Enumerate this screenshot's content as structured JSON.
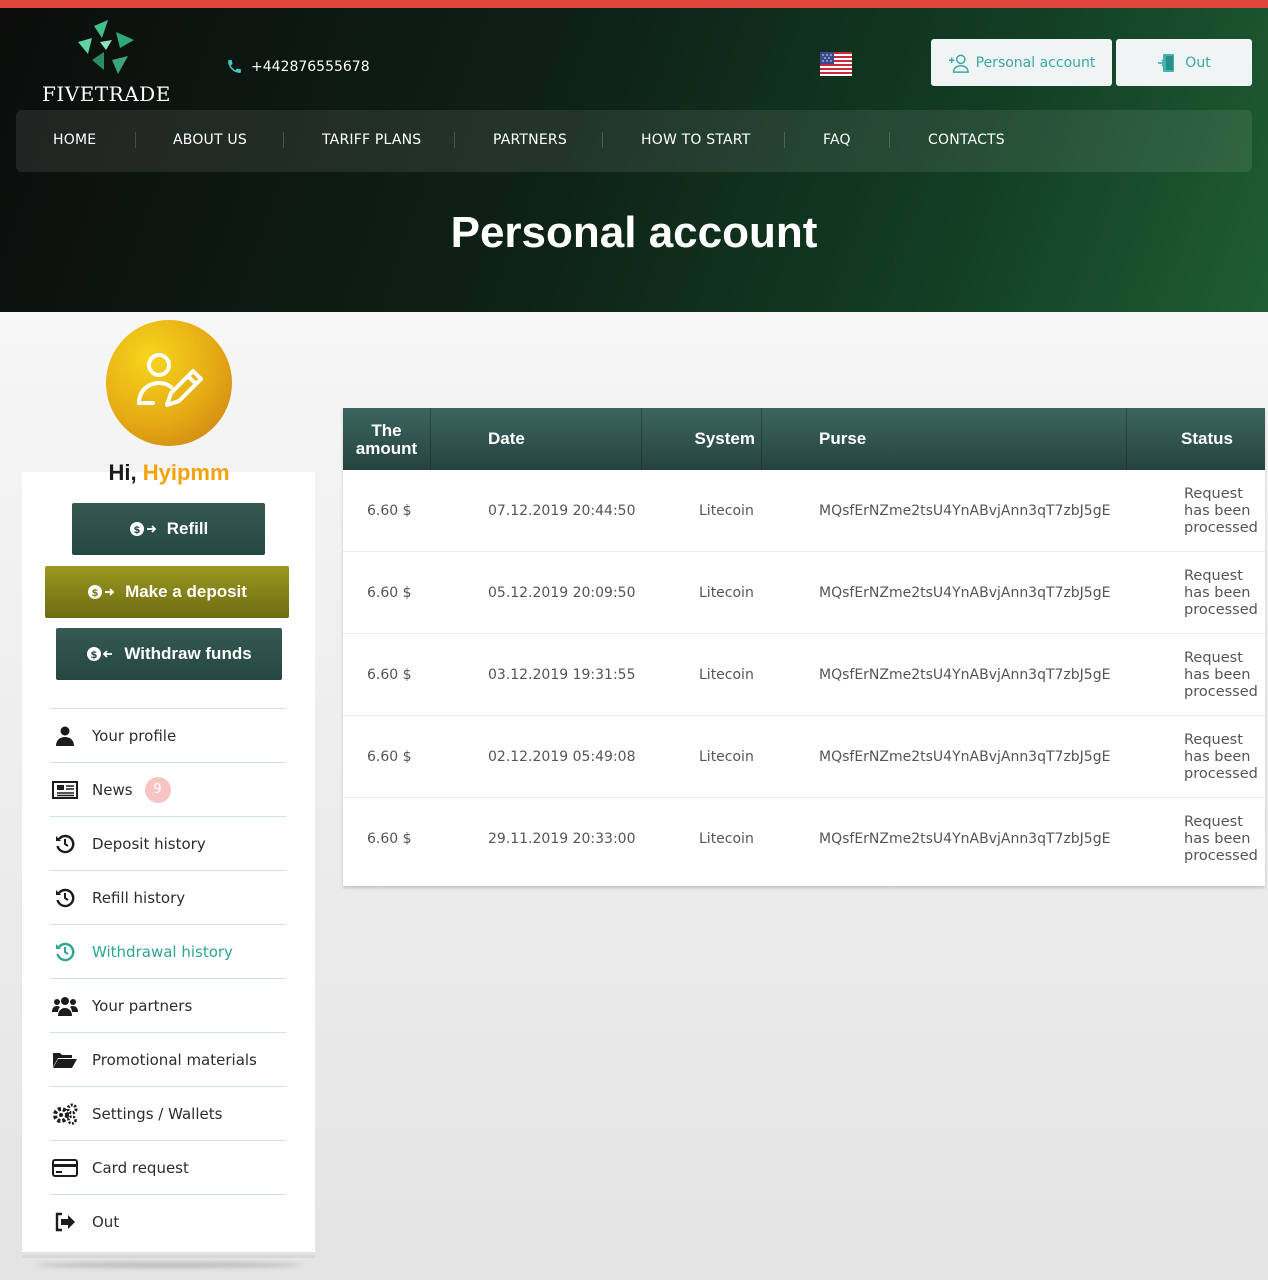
{
  "header": {
    "brand": "FIVETRADE",
    "phone": "+442876555678",
    "personal_account_button": "Personal account",
    "out_button": "Out",
    "nav": [
      "HOME",
      "ABOUT US",
      "TARIFF PLANS",
      "PARTNERS",
      "HOW TO START",
      "FAQ",
      "CONTACTS"
    ]
  },
  "page_title": "Personal account",
  "sidebar": {
    "greeting": "Hi,",
    "username": "Hyipmm",
    "buttons": {
      "refill": "Refill",
      "deposit": "Make a deposit",
      "withdraw": "Withdraw funds"
    },
    "menu": [
      {
        "label": "Your profile",
        "icon": "user-icon"
      },
      {
        "label": "News",
        "icon": "newspaper-icon",
        "badge": "9"
      },
      {
        "label": "Deposit history",
        "icon": "history-icon"
      },
      {
        "label": "Refill history",
        "icon": "history-icon"
      },
      {
        "label": "Withdrawal history",
        "icon": "history-icon",
        "active": true
      },
      {
        "label": "Your partners",
        "icon": "users-icon"
      },
      {
        "label": "Promotional materials",
        "icon": "folder-open-icon"
      },
      {
        "label": "Settings / Wallets",
        "icon": "gears-icon"
      },
      {
        "label": "Card request",
        "icon": "credit-card-icon"
      },
      {
        "label": "Out",
        "icon": "sign-out-icon"
      }
    ]
  },
  "table": {
    "headers": {
      "amount": "The amount",
      "date": "Date",
      "system": "System",
      "purse": "Purse",
      "status": "Status"
    },
    "rows": [
      {
        "amount": "6.60 $",
        "date": "07.12.2019 20:44:50",
        "system": "Litecoin",
        "purse": "MQsfErNZme2tsU4YnABvjAnn3qT7zbJ5gE",
        "status": "Request has been processed"
      },
      {
        "amount": "6.60 $",
        "date": "05.12.2019 20:09:50",
        "system": "Litecoin",
        "purse": "MQsfErNZme2tsU4YnABvjAnn3qT7zbJ5gE",
        "status": "Request has been processed"
      },
      {
        "amount": "6.60 $",
        "date": "03.12.2019 19:31:55",
        "system": "Litecoin",
        "purse": "MQsfErNZme2tsU4YnABvjAnn3qT7zbJ5gE",
        "status": "Request has been processed"
      },
      {
        "amount": "6.60 $",
        "date": "02.12.2019 05:49:08",
        "system": "Litecoin",
        "purse": "MQsfErNZme2tsU4YnABvjAnn3qT7zbJ5gE",
        "status": "Request has been processed"
      },
      {
        "amount": "6.60 $",
        "date": "29.11.2019 20:33:00",
        "system": "Litecoin",
        "purse": "MQsfErNZme2tsU4YnABvjAnn3qT7zbJ5gE",
        "status": "Request has been processed"
      }
    ]
  },
  "colors": {
    "top_line": "#e0463c",
    "accent_teal": "#2fa594",
    "username_gold": "#f2a20b",
    "table_header": "#2f524d",
    "deposit_button": "#8a8719"
  }
}
